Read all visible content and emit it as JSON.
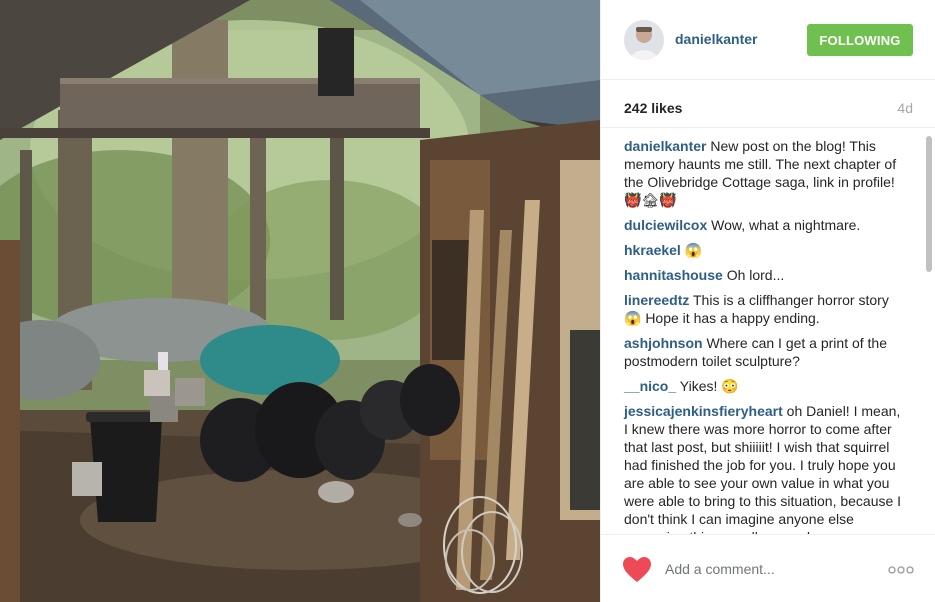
{
  "post": {
    "username": "danielkanter",
    "follow_label": "FOLLOWING",
    "likes": "242 likes",
    "age": "4d"
  },
  "comments": [
    {
      "user": "danielkanter",
      "text": "New post on the blog! This memory haunts me still. The next chapter of the Olivebridge Cottage saga, link in profile! 👹🏚👹"
    },
    {
      "user": "dulciewilcox",
      "text": "Wow, what a nightmare."
    },
    {
      "user": "hkraekel",
      "text": "😱"
    },
    {
      "user": "hannitashouse",
      "text": "Oh lord..."
    },
    {
      "user": "linereedtz",
      "text": "This is a cliffhanger horror story 😱 Hope it has a happy ending."
    },
    {
      "user": "ashjohnson",
      "text": "Where can I get a print of the postmodern toilet sculpture?"
    },
    {
      "user": "__nico_",
      "text": "Yikes! 😳"
    },
    {
      "user": "jessicajenkinsfieryheart",
      "text": "oh Daniel! I mean, I knew there was more horror to come after that last post, but shiiiiit! I wish that squirrel had finished the job for you. I truly hope you are able to see your own value in what you were able to bring to this situation, because I don't think I can imagine anyone else managing this as well as you have."
    }
  ],
  "footer": {
    "comment_placeholder": "Add a comment..."
  },
  "colors": {
    "accent_link": "#2e5e86",
    "follow_green": "#70c050",
    "like_red": "#ed4956",
    "muted": "#a5a7aa"
  },
  "icons": {
    "like": "heart-icon",
    "more": "more-options-icon"
  }
}
